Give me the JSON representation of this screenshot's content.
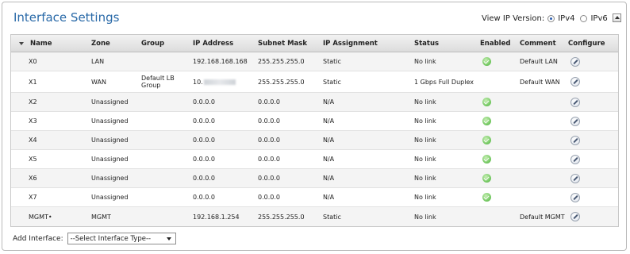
{
  "title": "Interface Settings",
  "ip_version": {
    "label": "View IP Version:",
    "options": [
      "IPv4",
      "IPv6"
    ],
    "selected": "IPv4"
  },
  "columns": [
    "Name",
    "Zone",
    "Group",
    "IP Address",
    "Subnet Mask",
    "IP Assignment",
    "Status",
    "Enabled",
    "Comment",
    "Configure"
  ],
  "rows": [
    {
      "name": "X0",
      "zone": "LAN",
      "group": "",
      "ip": "192.168.168.168",
      "mask": "255.255.255.0",
      "assign": "Static",
      "status": "No link",
      "enabled": true,
      "comment": "Default LAN"
    },
    {
      "name": "X1",
      "zone": "WAN",
      "group": "Default LB Group",
      "ip": "10.",
      "mask": "255.255.255.0",
      "assign": "Static",
      "status": "1 Gbps Full Duplex",
      "enabled": false,
      "comment": "Default WAN"
    },
    {
      "name": "X2",
      "zone": "Unassigned",
      "group": "",
      "ip": "0.0.0.0",
      "mask": "0.0.0.0",
      "assign": "N/A",
      "status": "No link",
      "enabled": true,
      "comment": ""
    },
    {
      "name": "X3",
      "zone": "Unassigned",
      "group": "",
      "ip": "0.0.0.0",
      "mask": "0.0.0.0",
      "assign": "N/A",
      "status": "No link",
      "enabled": true,
      "comment": ""
    },
    {
      "name": "X4",
      "zone": "Unassigned",
      "group": "",
      "ip": "0.0.0.0",
      "mask": "0.0.0.0",
      "assign": "N/A",
      "status": "No link",
      "enabled": true,
      "comment": ""
    },
    {
      "name": "X5",
      "zone": "Unassigned",
      "group": "",
      "ip": "0.0.0.0",
      "mask": "0.0.0.0",
      "assign": "N/A",
      "status": "No link",
      "enabled": true,
      "comment": ""
    },
    {
      "name": "X6",
      "zone": "Unassigned",
      "group": "",
      "ip": "0.0.0.0",
      "mask": "0.0.0.0",
      "assign": "N/A",
      "status": "No link",
      "enabled": true,
      "comment": ""
    },
    {
      "name": "X7",
      "zone": "Unassigned",
      "group": "",
      "ip": "0.0.0.0",
      "mask": "0.0.0.0",
      "assign": "N/A",
      "status": "No link",
      "enabled": true,
      "comment": ""
    },
    {
      "name": "MGMT•",
      "zone": "MGMT",
      "group": "",
      "ip": "192.168.1.254",
      "mask": "255.255.255.0",
      "assign": "Static",
      "status": "No link",
      "enabled": false,
      "comment": "Default MGMT"
    }
  ],
  "add_interface": {
    "label": "Add Interface:",
    "select_value": "--Select Interface Type--"
  },
  "icons": {
    "enabled": "check-circle-icon",
    "configure": "pencil-edit-icon",
    "collapse": "collapse-up-icon",
    "sort": "sort-down-icon"
  },
  "colors": {
    "title": "#2a6aa8",
    "enabled_green": "#6cc45a"
  }
}
